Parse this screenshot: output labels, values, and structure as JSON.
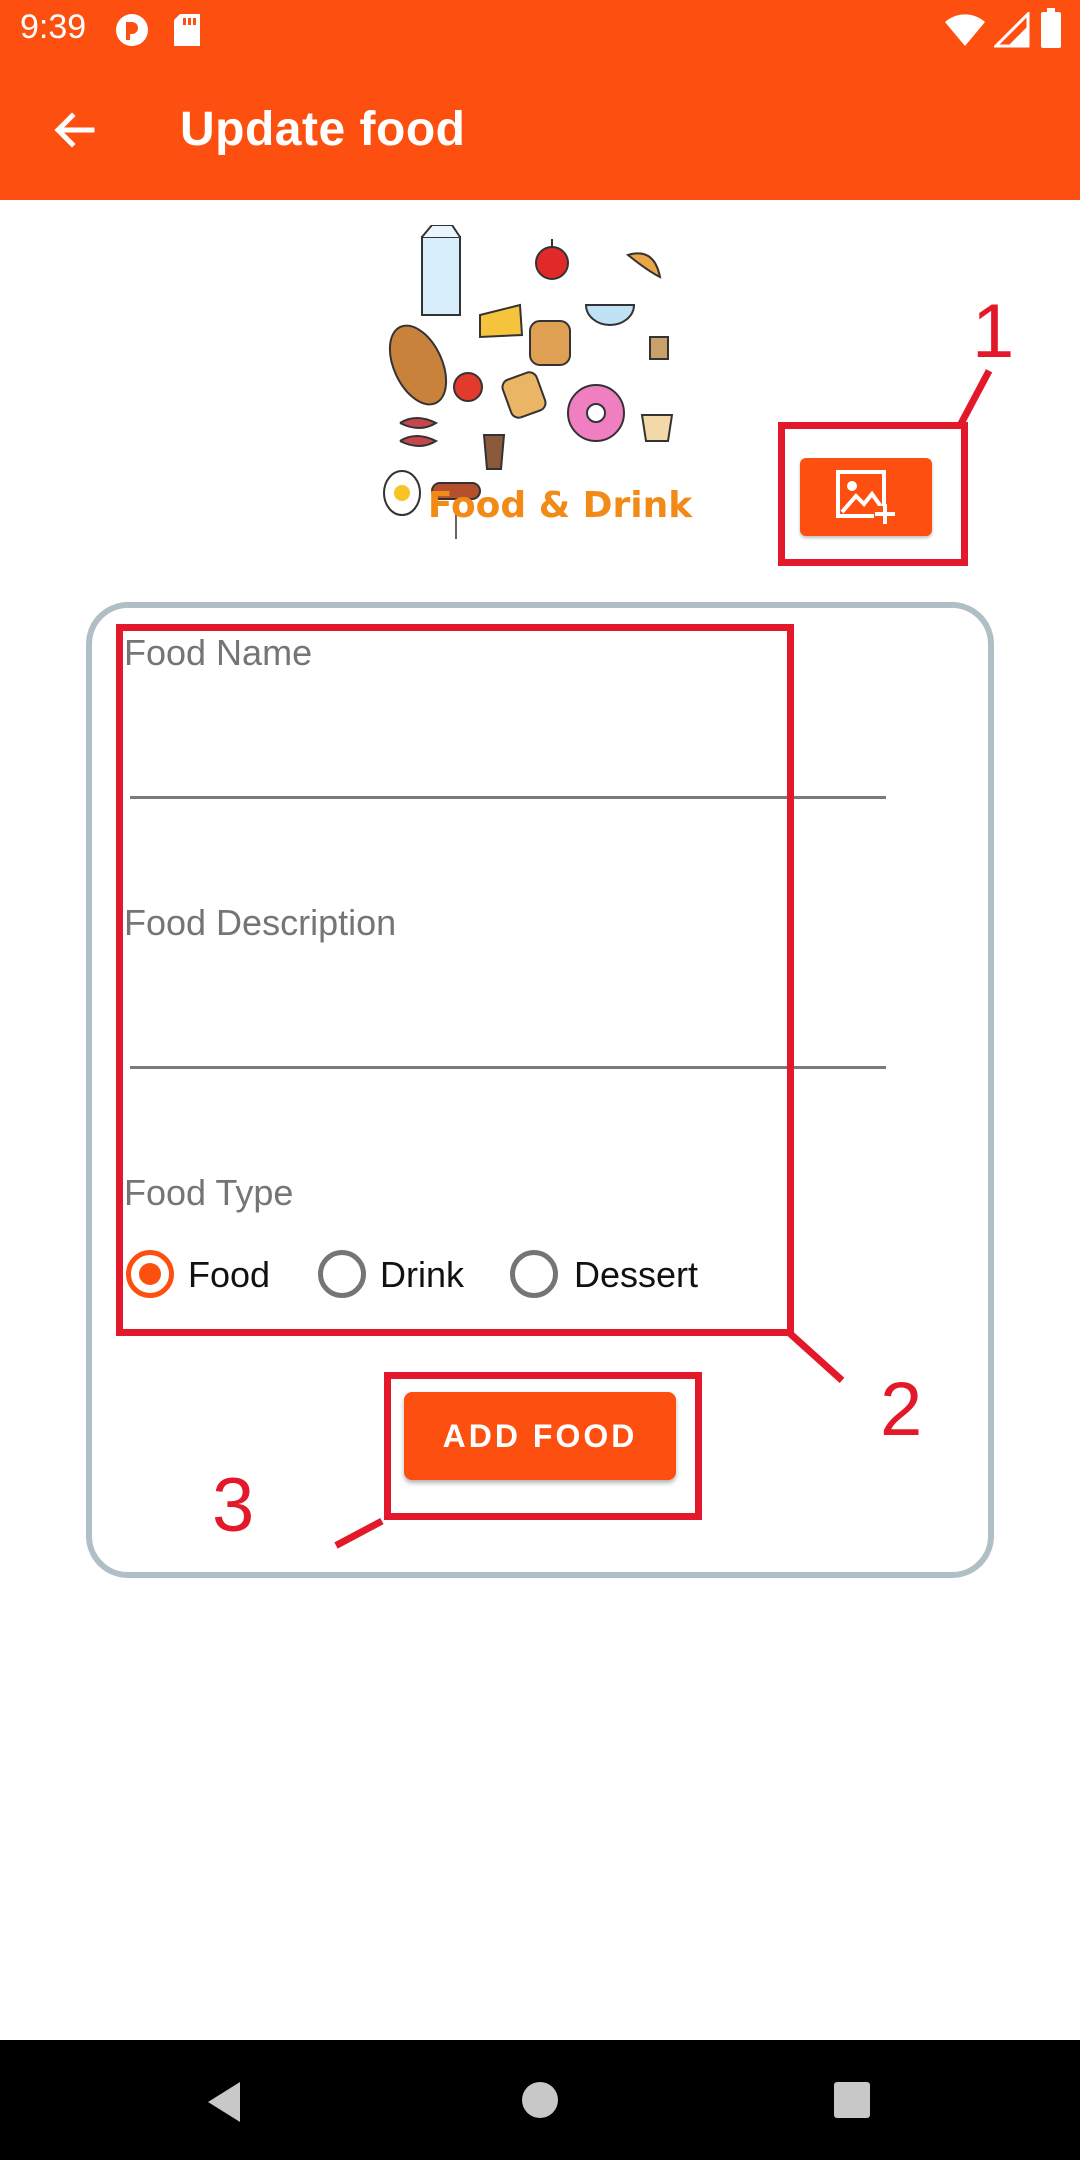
{
  "status_bar": {
    "time": "9:39",
    "icons": [
      "pocket-casts-icon",
      "sd-card-icon",
      "wifi-icon",
      "signal-icon",
      "battery-icon"
    ]
  },
  "app_bar": {
    "title": "Update food",
    "back_icon": "arrow-back-icon"
  },
  "hero_image": {
    "label": "Food & Drink"
  },
  "image_picker": {
    "icon": "add-photo-icon"
  },
  "form": {
    "food_name": {
      "label": "Food Name",
      "value": ""
    },
    "food_description": {
      "label": "Food Description",
      "value": ""
    },
    "food_type": {
      "label": "Food Type",
      "options": [
        "Food",
        "Drink",
        "Dessert"
      ],
      "selected": "Food"
    },
    "submit_label": "ADD FOOD"
  },
  "annotations": [
    "1",
    "2",
    "3"
  ],
  "colors": {
    "primary": "#fd5010",
    "annotation": "#e3192b",
    "card_border": "#b0bec5"
  }
}
